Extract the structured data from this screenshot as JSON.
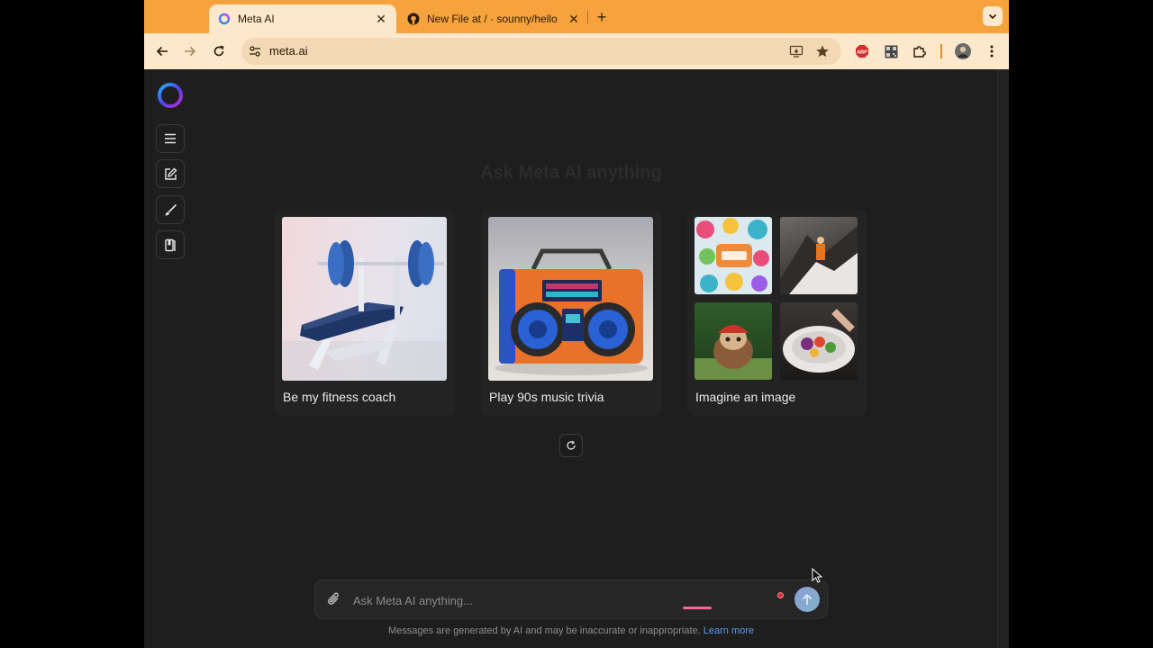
{
  "browser": {
    "tabs": [
      {
        "title": "Meta AI",
        "active": true,
        "icon": "meta-ai-favicon"
      },
      {
        "title": "New File at / · sounny/hello",
        "active": false,
        "icon": "github-favicon"
      }
    ],
    "url": "meta.ai",
    "accent_color": "#f6a23d"
  },
  "sidebar": {
    "items": [
      {
        "name": "menu",
        "icon": "hamburger-icon"
      },
      {
        "name": "new-chat",
        "icon": "edit-icon"
      },
      {
        "name": "imagine",
        "icon": "brush-icon"
      },
      {
        "name": "library",
        "icon": "book-icon"
      }
    ]
  },
  "main": {
    "heading": "Ask Meta AI anything",
    "cards": [
      {
        "label": "Be my fitness coach",
        "image": "weight-bench"
      },
      {
        "label": "Play 90s music trivia",
        "image": "boombox"
      },
      {
        "label": "Imagine an image",
        "image": "image-collage"
      }
    ]
  },
  "composer": {
    "placeholder": "Ask Meta AI anything...",
    "disclaimer": "Messages are generated by AI and may be inaccurate or inappropriate.",
    "learn_more": "Learn more"
  }
}
